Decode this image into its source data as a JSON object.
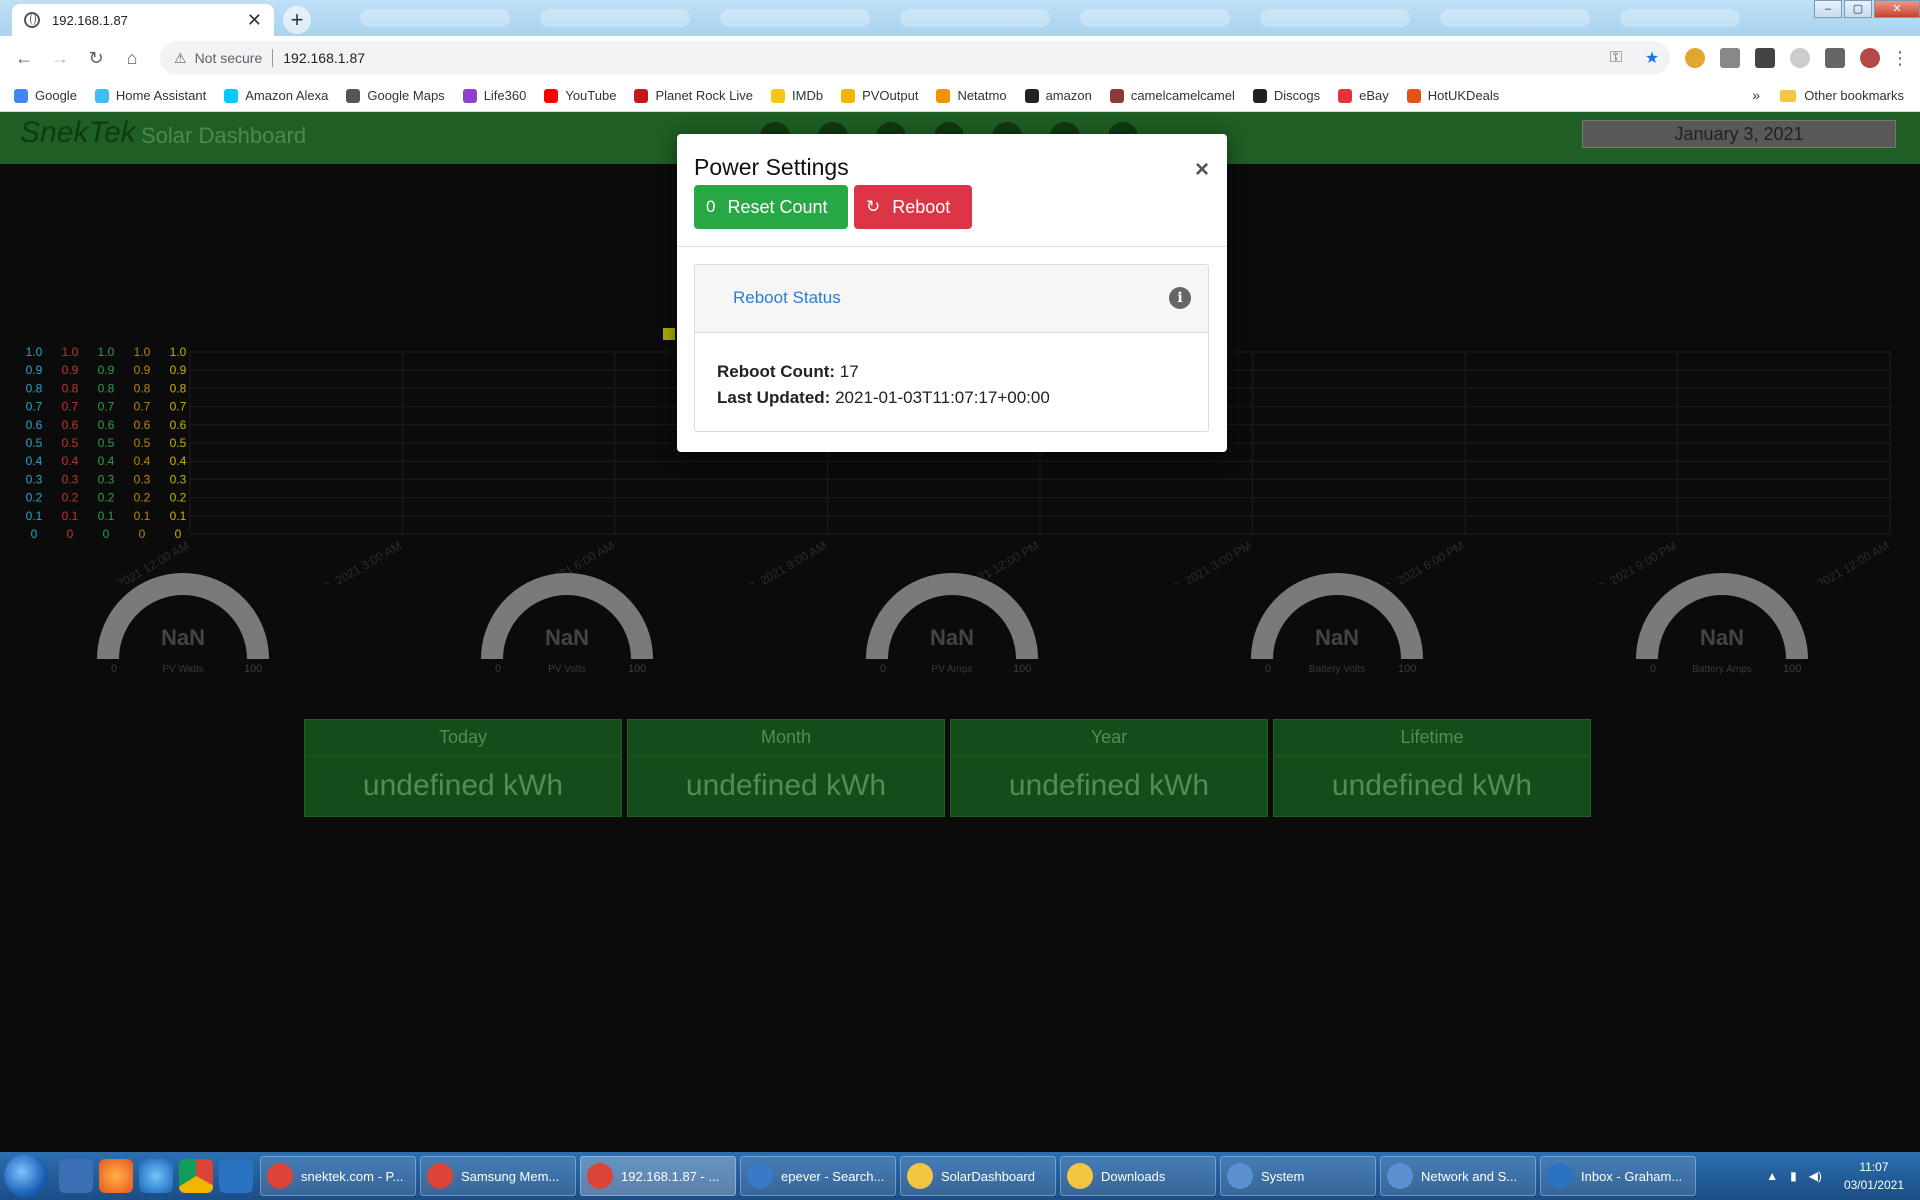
{
  "browser": {
    "tab_title": "192.168.1.87",
    "security_label": "Not secure",
    "url": "192.168.1.87",
    "bookmarks": [
      {
        "label": "Google",
        "color": "#4285f4"
      },
      {
        "label": "Home Assistant",
        "color": "#41bdf5"
      },
      {
        "label": "Amazon Alexa",
        "color": "#00caff"
      },
      {
        "label": "Google Maps",
        "color": "#555555"
      },
      {
        "label": "Life360",
        "color": "#8e3fd0"
      },
      {
        "label": "YouTube",
        "color": "#ff0000"
      },
      {
        "label": "Planet Rock Live",
        "color": "#c4181d"
      },
      {
        "label": "IMDb",
        "color": "#f5c518"
      },
      {
        "label": "PVOutput",
        "color": "#f2b705"
      },
      {
        "label": "Netatmo",
        "color": "#f39200"
      },
      {
        "label": "amazon",
        "color": "#222222"
      },
      {
        "label": "camelcamelcamel",
        "color": "#8b3a3a"
      },
      {
        "label": "Discogs",
        "color": "#222222"
      },
      {
        "label": "eBay",
        "color": "#e53238"
      },
      {
        "label": "HotUKDeals",
        "color": "#e8501a"
      }
    ],
    "more_glyph": "»",
    "other_bookmarks": "Other bookmarks"
  },
  "app": {
    "brand": "SnekTek",
    "subtitle": "Solar Dashboard",
    "date": "January 3, 2021",
    "gauges": [
      {
        "value": "NaN",
        "name": "PV Watts",
        "min": "0",
        "max": "100"
      },
      {
        "value": "NaN",
        "name": "PV Volts",
        "min": "0",
        "max": "100"
      },
      {
        "value": "NaN",
        "name": "PV Amps",
        "min": "0",
        "max": "100"
      },
      {
        "value": "NaN",
        "name": "Battery Volts",
        "min": "0",
        "max": "100"
      },
      {
        "value": "NaN",
        "name": "Battery Amps",
        "min": "0",
        "max": "100"
      }
    ],
    "tiles": [
      {
        "title": "Today",
        "value": "undefined kWh"
      },
      {
        "title": "Month",
        "value": "undefined kWh"
      },
      {
        "title": "Year",
        "value": "undefined kWh"
      },
      {
        "title": "Lifetime",
        "value": "undefined kWh"
      }
    ]
  },
  "chart_data": {
    "type": "line",
    "x": [
      "Jan 3, 2021 12:00 AM",
      "Jan 3, 2021 3:00 AM",
      "Jan 3, 2021 6:00 AM",
      "Jan 3, 2021 9:00 AM",
      "Jan 3, 2021 12:00 PM",
      "Jan 3, 2021 3:00 PM",
      "Jan 3, 2021 6:00 PM",
      "Jan 3, 2021 9:00 PM",
      "Jan 4, 2021 12:00 AM"
    ],
    "y_axes": [
      {
        "ticks": [
          "1.0",
          "0.9",
          "0.8",
          "0.7",
          "0.6",
          "0.5",
          "0.4",
          "0.3",
          "0.2",
          "0.1",
          "0"
        ],
        "color": "#2aa6c9"
      },
      {
        "ticks": [
          "1.0",
          "0.9",
          "0.8",
          "0.7",
          "0.6",
          "0.5",
          "0.4",
          "0.3",
          "0.2",
          "0.1",
          "0"
        ],
        "color": "#c0392b"
      },
      {
        "ticks": [
          "1.0",
          "0.9",
          "0.8",
          "0.7",
          "0.6",
          "0.5",
          "0.4",
          "0.3",
          "0.2",
          "0.1",
          "0"
        ],
        "color": "#2ea043"
      },
      {
        "ticks": [
          "1.0",
          "0.9",
          "0.8",
          "0.7",
          "0.6",
          "0.5",
          "0.4",
          "0.3",
          "0.2",
          "0.1",
          "0"
        ],
        "color": "#b8860b"
      },
      {
        "ticks": [
          "1.0",
          "0.9",
          "0.8",
          "0.7",
          "0.6",
          "0.5",
          "0.4",
          "0.3",
          "0.2",
          "0.1",
          "0"
        ],
        "color": "#c8b400"
      }
    ],
    "ylim": [
      0,
      1
    ],
    "series": [],
    "grid": true
  },
  "modal": {
    "title": "Power Settings",
    "close_glyph": "×",
    "reset_icon": "0",
    "reset_label": "Reset Count",
    "reboot_icon": "↻",
    "reboot_label": "Reboot",
    "card_title": "Reboot Status",
    "info_glyph": "i",
    "reboot_count_label": "Reboot Count:",
    "reboot_count": "17",
    "last_updated_label": "Last Updated:",
    "last_updated": "2021-01-03T11:07:17+00:00"
  },
  "taskbar": {
    "items": [
      {
        "label": "snektek.com - P...",
        "color": "#db4437"
      },
      {
        "label": "Samsung Mem...",
        "color": "#db4437"
      },
      {
        "label": "192.168.1.87 - ...",
        "color": "#db4437"
      },
      {
        "label": "epever - Search...",
        "color": "#3a78c8"
      },
      {
        "label": "SolarDashboard",
        "color": "#f4c542"
      },
      {
        "label": "Downloads",
        "color": "#f4c542"
      },
      {
        "label": "System",
        "color": "#5a8fd0"
      },
      {
        "label": "Network and S...",
        "color": "#5a8fd0"
      },
      {
        "label": "Inbox - Graham...",
        "color": "#2a72c2"
      }
    ],
    "time": "11:07",
    "date": "03/01/2021"
  }
}
